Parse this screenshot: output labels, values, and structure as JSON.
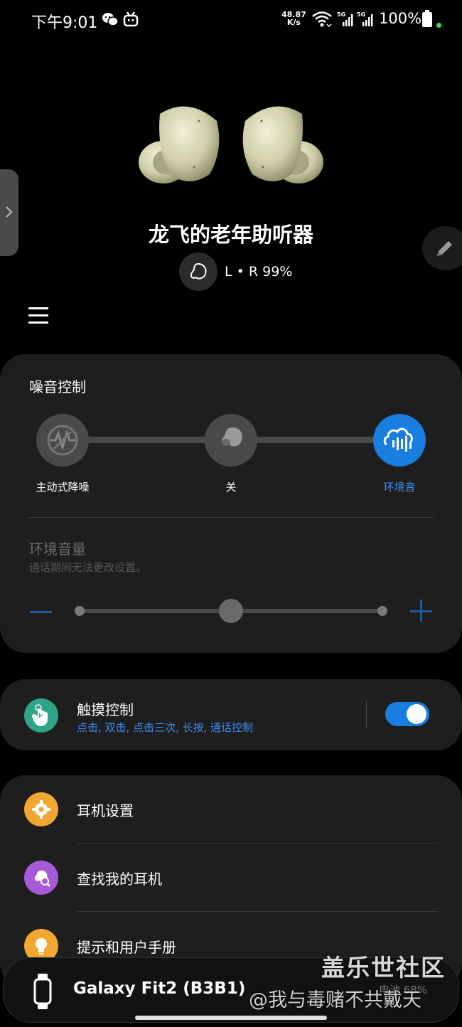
{
  "status_bar": {
    "time": "下午9:01",
    "net_speed_value": "48.87",
    "net_speed_unit": "K/s",
    "battery": "100%",
    "icons": [
      "wechat-icon",
      "bilibili-icon",
      "wifi-icon",
      "signal-5g-icon",
      "signal-5g-icon",
      "battery-icon"
    ]
  },
  "device": {
    "name": "龙飞的老年助听器",
    "battery": "L • R 99%"
  },
  "noise_control": {
    "title": "噪音控制",
    "options": [
      {
        "label": "主动式降噪",
        "icon": "anc-icon",
        "active": false
      },
      {
        "label": "关",
        "icon": "earbud-icon",
        "active": false
      },
      {
        "label": "环境音",
        "icon": "ambient-sound-icon",
        "active": true
      }
    ],
    "ambient_title": "环境音量",
    "ambient_subtitle": "通话期间无法更改设置。",
    "ambient_level": 0.5,
    "accent_color": "#1a7ee0"
  },
  "touch_control": {
    "title": "触摸控制",
    "subtitle": "点击, 双击, 点击三次, 长按, 通话控制",
    "enabled": true
  },
  "settings": {
    "items": [
      {
        "label": "耳机设置",
        "icon": "gear-icon",
        "color": "#f0a832"
      },
      {
        "label": "查找我的耳机",
        "icon": "find-earbuds-icon",
        "color": "#a55ad8"
      },
      {
        "label": "提示和用户手册",
        "icon": "lightbulb-icon",
        "color": "#f0a832"
      }
    ]
  },
  "bottom": {
    "watch_name": "Galaxy Fit2 (B3B1)",
    "watch_battery": "电池 68%"
  },
  "watermark": {
    "title": "盖乐世社区",
    "subtitle": "@我与毒赌不共戴天"
  }
}
